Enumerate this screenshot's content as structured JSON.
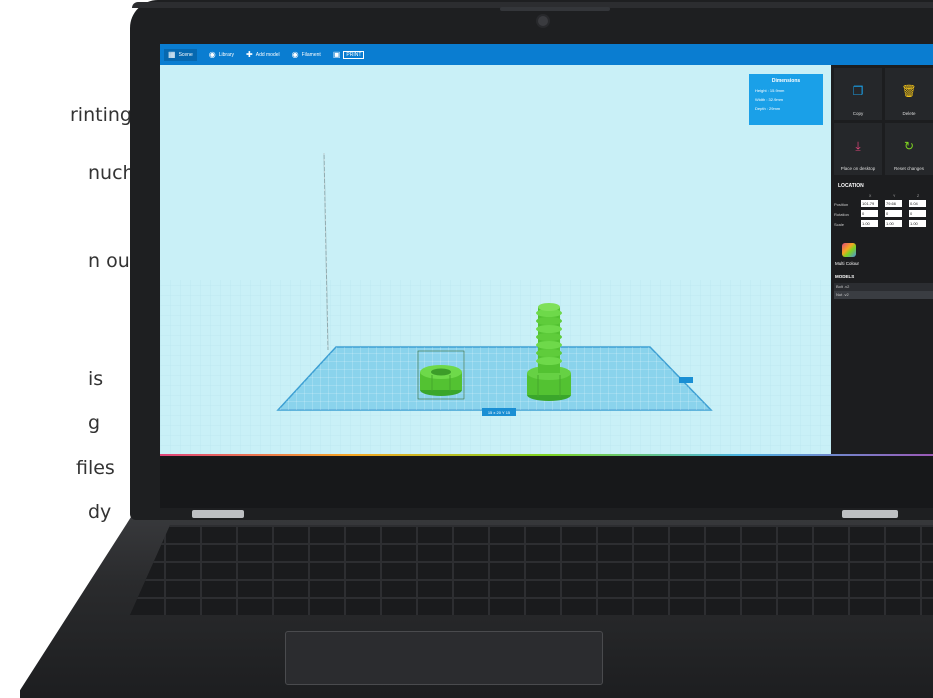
{
  "left_text": [
    "rinting",
    "nuch",
    "n our",
    "is",
    "g",
    "files",
    "dy"
  ],
  "toolbar": {
    "items": [
      {
        "icon": "grid-icon",
        "label": "Scene"
      },
      {
        "icon": "library-icon",
        "label": "Library"
      },
      {
        "icon": "add-icon",
        "label": "Add model"
      },
      {
        "icon": "filament-icon",
        "label": "Filament"
      }
    ],
    "print_label": "PRINT",
    "color": "#0a7dd1"
  },
  "dimensions": {
    "title": "Dimensions",
    "height": "Height : 15.9mm",
    "width": "Width : 32.9mm",
    "depth": "Depth : 29mm"
  },
  "panel": {
    "tiles": [
      {
        "icon": "copy-icon",
        "label": "Copy",
        "color": "#1aa0e8"
      },
      {
        "icon": "trash-icon",
        "label": "Delete",
        "color": "#f5c518"
      },
      {
        "icon": "download-icon",
        "label": "Place on desktop",
        "color": "#e0457b"
      },
      {
        "icon": "undo-icon",
        "label": "Reset changes",
        "color": "#7ed321"
      }
    ],
    "location_title": "LOCATION",
    "axis_labels": [
      "X",
      "Y",
      "Z"
    ],
    "rows": [
      {
        "label": "Position",
        "values": [
          "101.79",
          "79.66",
          "0.04"
        ]
      },
      {
        "label": "Rotation",
        "values": [
          "0",
          "0",
          "0"
        ]
      },
      {
        "label": "Scale",
        "values": [
          "1.00",
          "1.00",
          "1.00"
        ]
      }
    ],
    "multi_colour": "Multi Colour",
    "models_title": "MODELS",
    "models": [
      "Bolt .v2",
      "Nut .v2"
    ]
  },
  "build_plate_label": "15 x 20 Y 15"
}
